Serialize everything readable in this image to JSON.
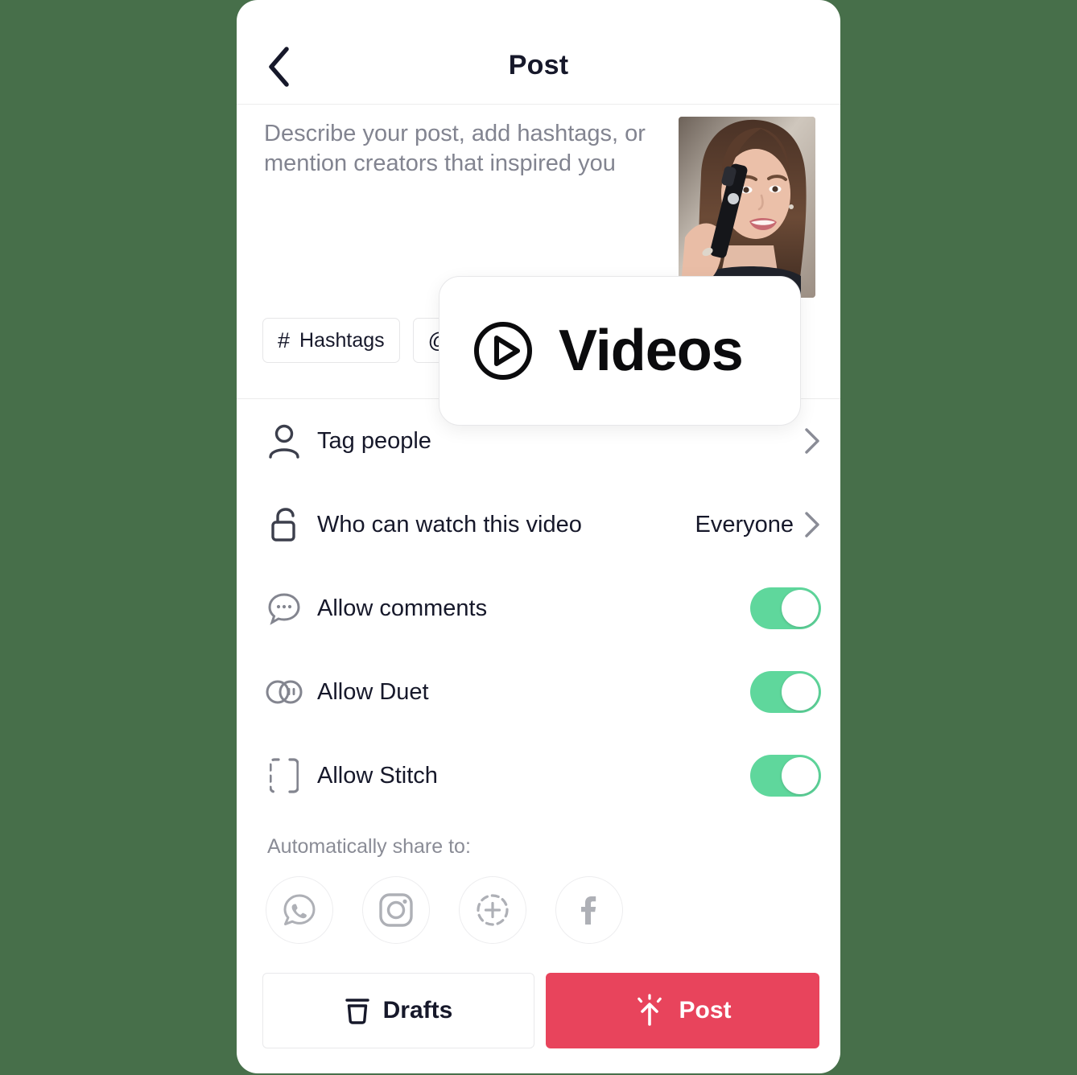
{
  "background_color": "#476f4a",
  "header": {
    "title": "Post",
    "back_icon": "chevron-left-icon"
  },
  "description": {
    "placeholder": "Describe your post, add hashtags, or mention creators that inspired you",
    "value": "",
    "thumbnail_alt": "video-thumbnail"
  },
  "pills": [
    {
      "glyph": "#",
      "label": "Hashtags",
      "icon": "hashtag-icon"
    },
    {
      "glyph": "@",
      "label": "",
      "icon": "mention-icon"
    }
  ],
  "settings": [
    {
      "icon": "person-icon",
      "label": "Tag people",
      "type": "nav",
      "value": ""
    },
    {
      "icon": "unlock-icon",
      "label": "Who can watch this video",
      "type": "nav",
      "value": "Everyone"
    },
    {
      "icon": "comment-icon",
      "label": "Allow comments",
      "type": "toggle",
      "on": true
    },
    {
      "icon": "duet-icon",
      "label": "Allow Duet",
      "type": "toggle",
      "on": true
    },
    {
      "icon": "stitch-icon",
      "label": "Allow Stitch",
      "type": "toggle",
      "on": true
    }
  ],
  "share": {
    "label": "Automatically share to:",
    "targets": [
      {
        "icon": "whatsapp-icon",
        "name": "WhatsApp"
      },
      {
        "icon": "instagram-icon",
        "name": "Instagram"
      },
      {
        "icon": "instagram-story-icon",
        "name": "Instagram Story"
      },
      {
        "icon": "facebook-icon",
        "name": "Facebook"
      }
    ]
  },
  "bottom": {
    "drafts_label": "Drafts",
    "drafts_icon": "drafts-box-icon",
    "post_label": "Post",
    "post_icon": "post-upload-icon",
    "post_color": "#e8445c"
  },
  "overlay_card": {
    "label": "Videos",
    "icon": "play-circle-icon"
  },
  "colors": {
    "toggle_on": "#5fd79c",
    "accent_red": "#e8445c",
    "text_primary": "#16182a",
    "text_muted": "#828490",
    "divider": "#ececec"
  }
}
